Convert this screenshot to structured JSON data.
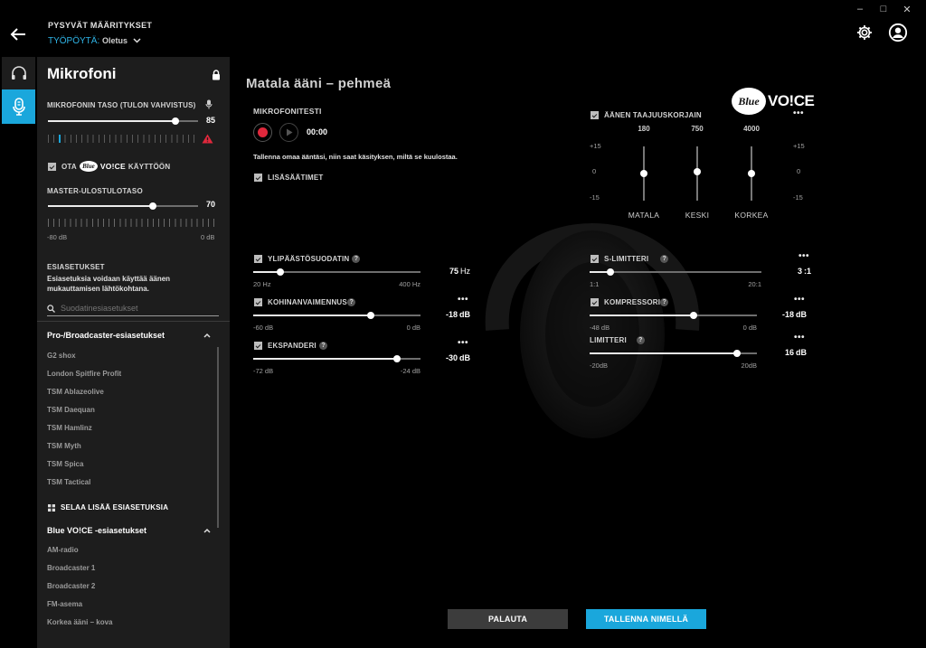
{
  "header": {
    "profile_label": "PYSYVÄT MÄÄRITYKSET",
    "profile_prefix": "TYÖPÖYTÄ:",
    "profile_value": "Oletus"
  },
  "window_controls": [
    "–",
    "□",
    "✕"
  ],
  "panel": {
    "title": "Mikrofoni",
    "mic_level_label": "MIKROFONIN TASO (TULON VAHVISTUS)",
    "mic_level_value": "85",
    "mic_level_fraction": 0.85,
    "enable_prefix": "OTA",
    "enable_logo_text": "Blue",
    "enable_suffix_voice": "VO!CE",
    "enable_suffix": "KÄYTTÖÖN",
    "master_label": "MASTER-ULOSTULOTASO",
    "master_value": "70",
    "master_fraction": 0.7,
    "master_min": "-80 dB",
    "master_max": "0 dB",
    "presets_label": "ESIASETUKSET",
    "presets_desc_1": "Esiasetuksia voidaan käyttää äänen",
    "presets_desc_2": "mukauttamisen lähtökohtana.",
    "filter_placeholder": "Suodatinesiasetukset",
    "pro_section": "Pro-/Broadcaster-esiasetukset",
    "pro_items": [
      "G2 shox",
      "London Spitfire Profit",
      "TSM Ablazeolive",
      "TSM Daequan",
      "TSM Hamlinz",
      "TSM Myth",
      "TSM Spica",
      "TSM Tactical"
    ],
    "browse_more": "SELAA LISÄÄ ESIASETUKSIA",
    "blue_section": "Blue VO!CE -esiasetukset",
    "blue_items": [
      "AM-radio",
      "Broadcaster 1",
      "Broadcaster 2",
      "FM-asema",
      "Korkea ääni – kova"
    ]
  },
  "main": {
    "title": "Matala ääni – pehmeä",
    "mic_test_label": "MIKROFONITESTI",
    "timer": "00:00",
    "mic_test_hint": "Tallenna omaa ääntäsi, niin saat käsityksen, miltä se kuulostaa.",
    "advanced_label": "LISÄSÄÄTIMET",
    "logo_blue": "Blue",
    "logo_voice": "VO!CE",
    "eq": {
      "label": "ÄÄNEN TAAJUUSKORJAIN",
      "db_top": "+15",
      "db_mid": "0",
      "db_bot": "-15",
      "bands": [
        {
          "freq": "180",
          "name": "MATALA",
          "gain": 0
        },
        {
          "freq": "750",
          "name": "KESKI",
          "gain": 1
        },
        {
          "freq": "4000",
          "name": "KORKEA",
          "gain": 0
        }
      ]
    },
    "highpass": {
      "label": "YLIPÄÄSTÖSUODATIN",
      "value": "75",
      "unit": "Hz",
      "min": "20 Hz",
      "max": "400 Hz",
      "fraction": 0.16
    },
    "noise": {
      "label": "KOHINANVAIMENNUS",
      "value": "-18",
      "unit": "dB",
      "min": "-60 dB",
      "max": "0 dB",
      "fraction": 0.7
    },
    "expander": {
      "label": "EKSPANDERI",
      "value": "-30",
      "unit": "dB",
      "min": "-72 dB",
      "max": "-24 dB",
      "fraction": 0.86
    },
    "slimiter": {
      "label": "S-LIMITTERI",
      "value": "3",
      "unit": ":1",
      "min": "1:1",
      "max": "20:1",
      "fraction": 0.12
    },
    "compressor": {
      "label": "KOMPRESSORI",
      "value": "-18",
      "unit": "dB",
      "min": "-48 dB",
      "max": "0 dB",
      "fraction": 0.62
    },
    "limiter": {
      "label": "LIMITTERI",
      "value": "16",
      "unit": "dB",
      "min": "-20dB",
      "max": "20dB",
      "fraction": 0.88
    },
    "more": "•••",
    "help": "?"
  },
  "buttons": {
    "reset": "PALAUTA",
    "save_as": "TALLENNA NIMELLÄ"
  },
  "colors": {
    "accent": "#1aa7dc",
    "warning": "#e0283c",
    "record": "#e0283c"
  }
}
